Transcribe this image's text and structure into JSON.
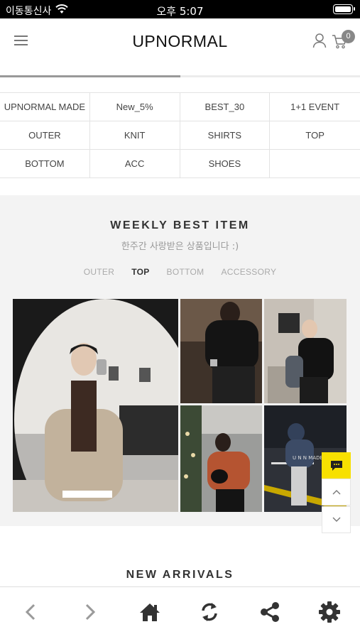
{
  "status_bar": {
    "carrier": "이동통신사",
    "time": "오후 5:07"
  },
  "header": {
    "brand": "UPNORMAL",
    "cart_count": "0"
  },
  "menu_progress": 0.5,
  "categories": [
    [
      "UPNORMAL MADE",
      "New_5%",
      "BEST_30",
      "1+1 EVENT"
    ],
    [
      "OUTER",
      "KNIT",
      "SHIRTS",
      "TOP"
    ],
    [
      "BOTTOM",
      "ACC",
      "SHOES"
    ]
  ],
  "weekly_best": {
    "title": "WEEKLY BEST ITEM",
    "subtitle": "한주간 사랑받은 상품입니다 :)",
    "tabs": [
      "OUTER",
      "TOP",
      "BOTTOM",
      "ACCESSORY"
    ],
    "active_tab": "TOP"
  },
  "new_arrivals": {
    "title": "NEW ARRIVALS"
  },
  "icons": {
    "menu": "hamburger-icon",
    "user": "user-icon",
    "cart": "cart-icon",
    "chat": "chat-bubble-icon",
    "scroll_up": "chevron-up-icon",
    "scroll_down": "chevron-down-icon",
    "back": "chevron-left-icon",
    "forward": "chevron-right-icon",
    "home": "home-icon",
    "refresh": "refresh-icon",
    "share": "share-icon",
    "settings": "gear-icon"
  },
  "colors": {
    "accent_chat": "#f7e000",
    "toolbar_icon": "#333333"
  }
}
